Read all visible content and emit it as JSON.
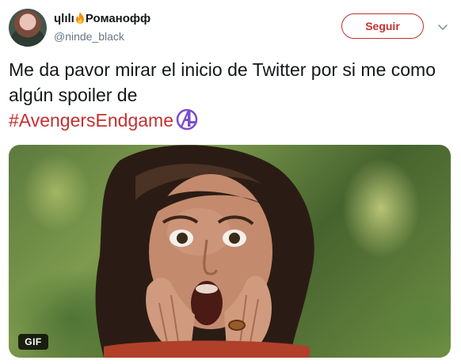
{
  "user": {
    "name_prefix": "ɥlılı",
    "name_suffix": "Романофф",
    "handle": "@ninde_black"
  },
  "follow_button": {
    "label": "Seguir"
  },
  "tweet": {
    "text": "Me da pavor mirar el inicio de Twitter por si me como algún spoiler de",
    "hashtag": "#AvengersEndgame"
  },
  "media": {
    "badge": "GIF"
  },
  "icons": {
    "name_emoji": "fire-icon",
    "hashtag_emoji": "avengers-logo-icon",
    "more_menu": "chevron-down-icon"
  },
  "colors": {
    "accent": "#c2312f",
    "hashtag_icon": "#7b4fc9",
    "handle_gray": "#657786"
  }
}
